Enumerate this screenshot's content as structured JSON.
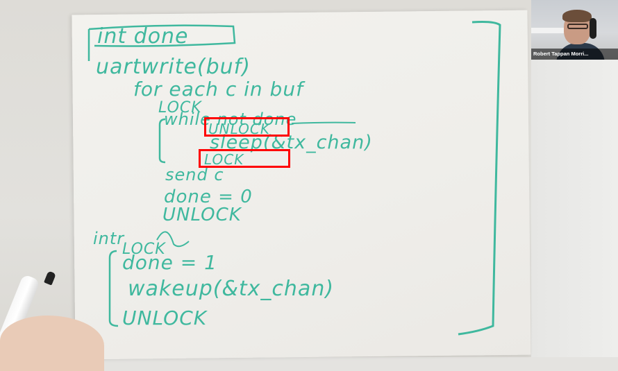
{
  "participant": {
    "name": "Robert Tappan Morri..."
  },
  "whiteboard": {
    "ink_color": "#3fb89e",
    "lines": [
      "int done",
      "uartwrite(buf)",
      "for each c in buf",
      "LOCK",
      "while not done",
      "UNLOCK",
      "sleep(&tx_chan)",
      "LOCK",
      "send c",
      "done = 0",
      "UNLOCK",
      "intr",
      "LOCK",
      "done = 1",
      "wakeup(&tx_chan)",
      "UNLOCK"
    ]
  },
  "highlights": {
    "color": "#ff0000"
  }
}
